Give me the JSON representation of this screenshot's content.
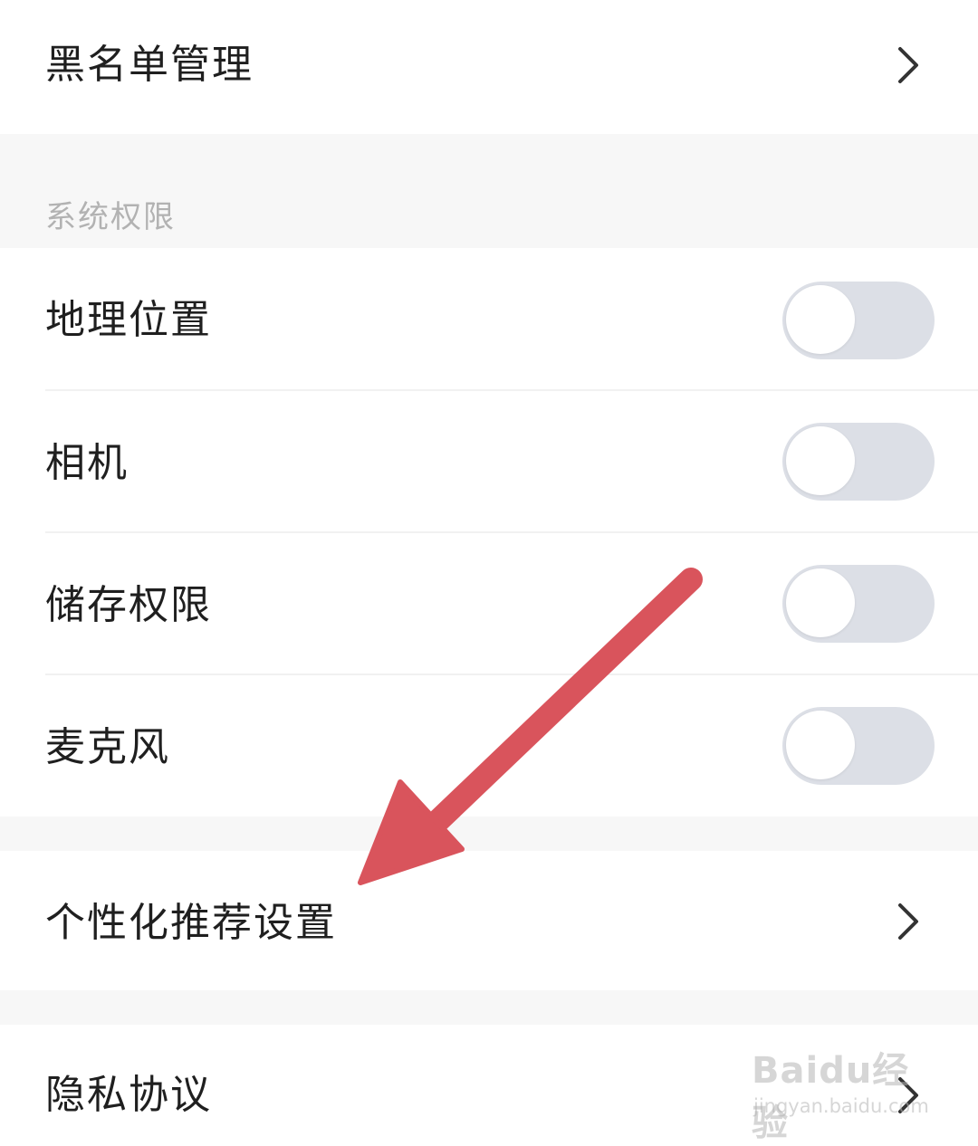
{
  "rows": {
    "blacklist": {
      "label": "黑名单管理",
      "icon": "chevron-right-icon"
    },
    "personalized": {
      "label": "个性化推荐设置",
      "icon": "chevron-right-icon"
    },
    "privacy": {
      "label": "隐私协议",
      "icon": "chevron-right-icon"
    }
  },
  "section": {
    "title": "系统权限"
  },
  "permissions": [
    {
      "label": "地理位置",
      "enabled": false
    },
    {
      "label": "相机",
      "enabled": false
    },
    {
      "label": "储存权限",
      "enabled": false
    },
    {
      "label": "麦克风",
      "enabled": false
    }
  ],
  "annotation": {
    "arrow_color": "#d9545c"
  },
  "watermark": {
    "brand": "Baidu经验",
    "url": "jingyan.baidu.com"
  },
  "colors": {
    "toggle_off": "#dcdfe6",
    "section_bg": "#f7f7f7",
    "text": "#1f1f1f",
    "muted": "#b2b2b2"
  }
}
